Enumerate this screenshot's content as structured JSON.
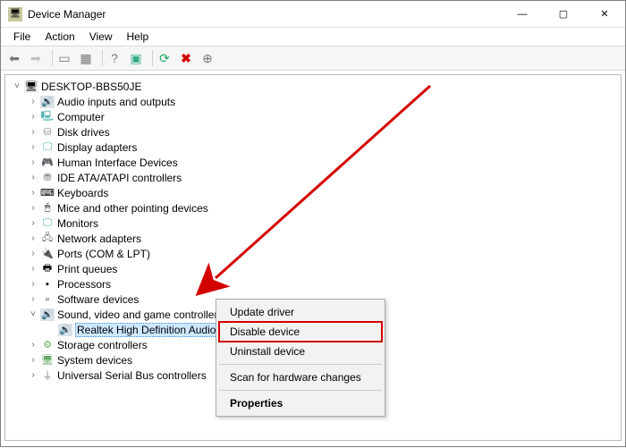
{
  "window": {
    "title": "Device Manager"
  },
  "menus": {
    "file": "File",
    "action": "Action",
    "view": "View",
    "help": "Help"
  },
  "root": "DESKTOP-BBS50JE",
  "selected_device": "Realtek High Definition Audio",
  "categories": {
    "audio_io": "Audio inputs and outputs",
    "computer": "Computer",
    "disk": "Disk drives",
    "display": "Display adapters",
    "hid": "Human Interface Devices",
    "ide": "IDE ATA/ATAPI controllers",
    "keyboards": "Keyboards",
    "mice": "Mice and other pointing devices",
    "monitors": "Monitors",
    "network": "Network adapters",
    "ports": "Ports (COM & LPT)",
    "printq": "Print queues",
    "processors": "Processors",
    "software": "Software devices",
    "sound": "Sound, video and game controllers",
    "storage": "Storage controllers",
    "system": "System devices",
    "usb": "Universal Serial Bus controllers"
  },
  "context_menu": {
    "update": "Update driver",
    "disable": "Disable device",
    "uninstall": "Uninstall device",
    "scan": "Scan for hardware changes",
    "properties": "Properties"
  },
  "accent_red": "#d40000",
  "highlighted_menu_item": "disable"
}
